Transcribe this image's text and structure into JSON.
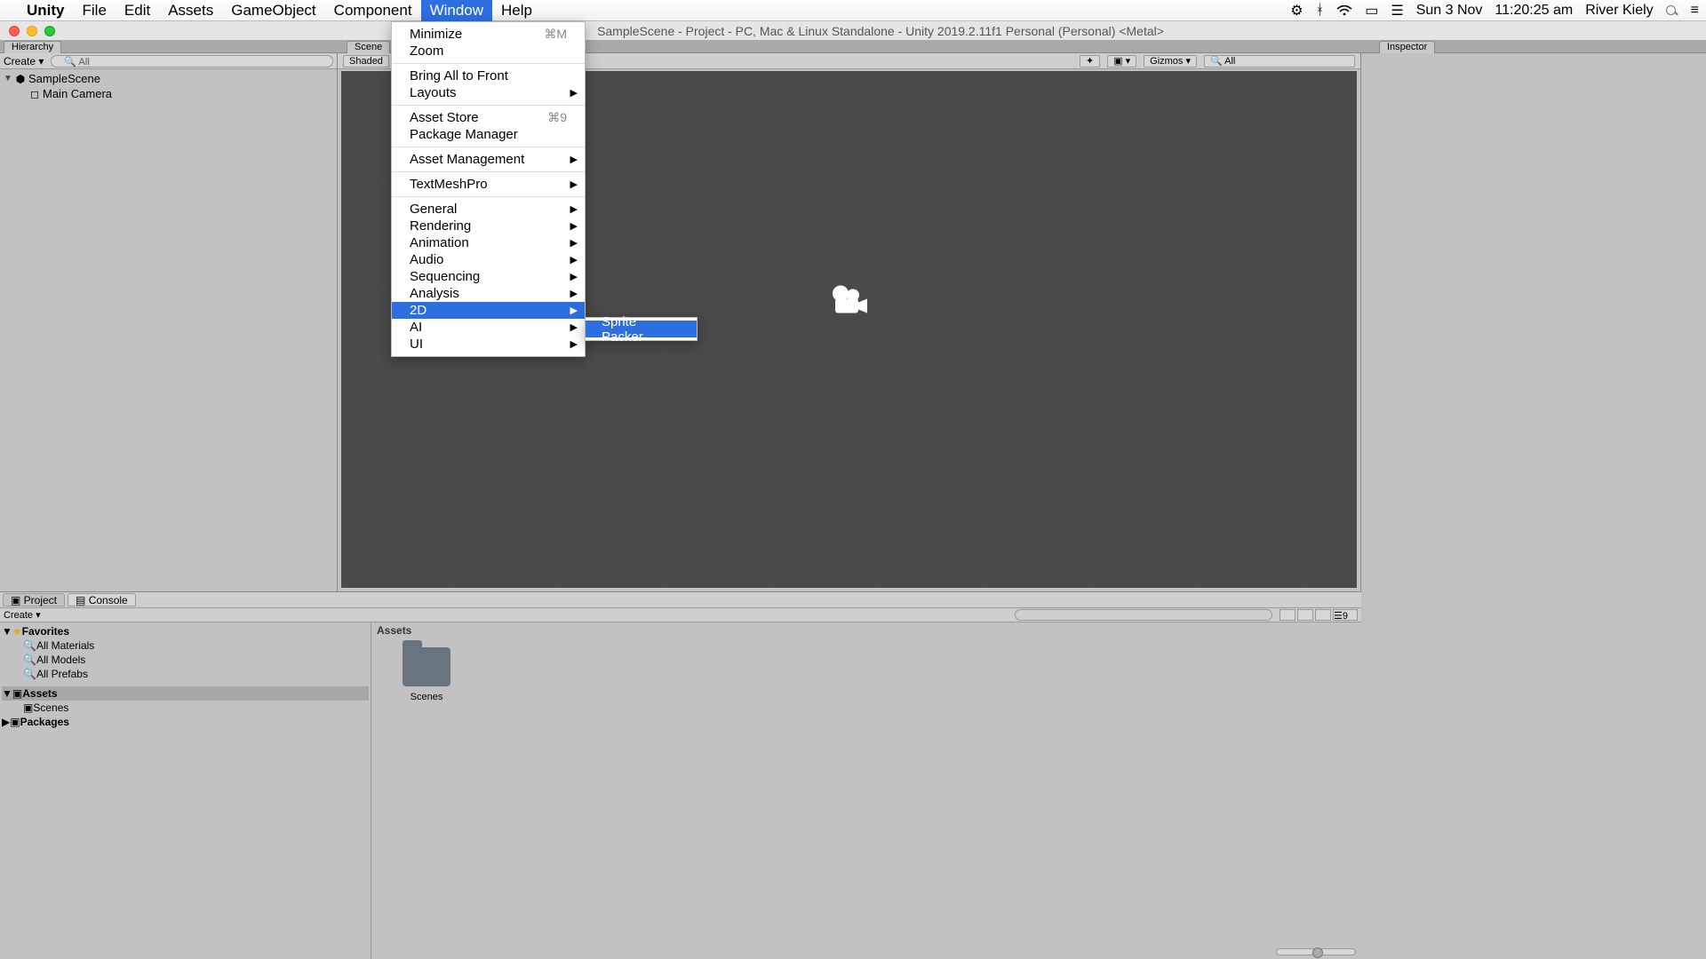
{
  "menubar": {
    "app": "Unity",
    "items": [
      "File",
      "Edit",
      "Assets",
      "GameObject",
      "Component",
      "Window",
      "Help"
    ],
    "active_index": 5,
    "right": {
      "date": "Sun 3 Nov",
      "time": "11:20:25 am",
      "user": "River Kiely"
    }
  },
  "window_title": "SampleScene - Project - PC, Mac & Linux Standalone - Unity 2019.2.11f1 Personal (Personal) <Metal>",
  "hierarchy": {
    "create_label": "Create",
    "search_placeholder": "All",
    "scene": "SampleScene",
    "children": [
      "Main Camera"
    ]
  },
  "scene_toolbar": {
    "shaded": "Shaded",
    "gizmos": "Gizmos",
    "search_placeholder": "All"
  },
  "inspector": {
    "title": "Inspector"
  },
  "project": {
    "tabs": [
      "Project",
      "Console"
    ],
    "active_tab": 0,
    "create_label": "Create",
    "favorites_label": "Favorites",
    "favorites": [
      "All Materials",
      "All Models",
      "All Prefabs"
    ],
    "assets_label": "Assets",
    "assets_children": [
      "Scenes"
    ],
    "packages_label": "Packages",
    "grid_header": "Assets",
    "grid_folder": "Scenes",
    "layers_badge": "9"
  },
  "dropdown": {
    "groups": [
      [
        {
          "label": "Minimize",
          "shortcut": "⌘M"
        },
        {
          "label": "Zoom"
        }
      ],
      [
        {
          "label": "Bring All to Front"
        },
        {
          "label": "Layouts",
          "sub": true
        }
      ],
      [
        {
          "label": "Asset Store",
          "shortcut": "⌘9"
        },
        {
          "label": "Package Manager"
        }
      ],
      [
        {
          "label": "Asset Management",
          "sub": true
        }
      ],
      [
        {
          "label": "TextMeshPro",
          "sub": true
        }
      ],
      [
        {
          "label": "General",
          "sub": true
        },
        {
          "label": "Rendering",
          "sub": true
        },
        {
          "label": "Animation",
          "sub": true
        },
        {
          "label": "Audio",
          "sub": true
        },
        {
          "label": "Sequencing",
          "sub": true
        },
        {
          "label": "Analysis",
          "sub": true
        },
        {
          "label": "2D",
          "sub": true,
          "highlight": true
        },
        {
          "label": "AI",
          "sub": true
        },
        {
          "label": "UI",
          "sub": true
        }
      ]
    ]
  },
  "submenu": {
    "items": [
      {
        "label": "Sprite Packer",
        "highlight": true
      }
    ]
  }
}
